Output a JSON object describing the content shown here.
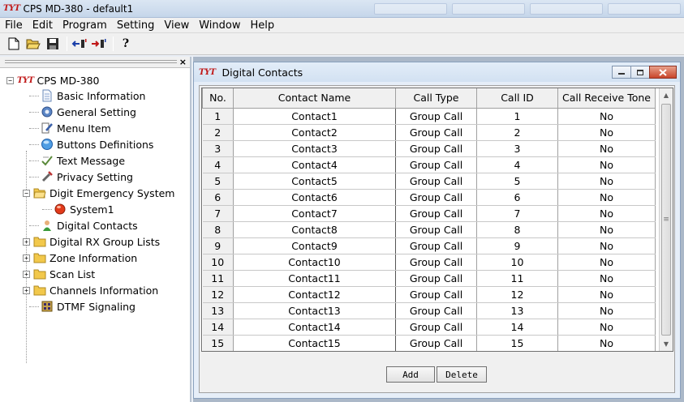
{
  "app": {
    "logo_text": "TYT",
    "title": "CPS MD-380 - default1"
  },
  "menu": [
    "File",
    "Edit",
    "Program",
    "Setting",
    "View",
    "Window",
    "Help"
  ],
  "toolbar": {
    "help_glyph": "?"
  },
  "tree": {
    "close_glyph": "×",
    "root_label": "CPS MD-380",
    "items": [
      {
        "label": "Basic Information"
      },
      {
        "label": "General Setting"
      },
      {
        "label": "Menu Item"
      },
      {
        "label": "Buttons Definitions"
      },
      {
        "label": "Text Message"
      },
      {
        "label": "Privacy Setting"
      },
      {
        "label": "Digit Emergency System"
      },
      {
        "label": "System1"
      },
      {
        "label": "Digital Contacts"
      },
      {
        "label": "Digital RX Group Lists"
      },
      {
        "label": "Zone Information"
      },
      {
        "label": "Scan List"
      },
      {
        "label": "Channels Information"
      },
      {
        "label": "DTMF Signaling"
      }
    ]
  },
  "window": {
    "title": "Digital Contacts",
    "columns": [
      "No.",
      "Contact Name",
      "Call Type",
      "Call ID",
      "Call Receive Tone"
    ],
    "rows": [
      [
        "1",
        "Contact1",
        "Group Call",
        "1",
        "No"
      ],
      [
        "2",
        "Contact2",
        "Group Call",
        "2",
        "No"
      ],
      [
        "3",
        "Contact3",
        "Group Call",
        "3",
        "No"
      ],
      [
        "4",
        "Contact4",
        "Group Call",
        "4",
        "No"
      ],
      [
        "5",
        "Contact5",
        "Group Call",
        "5",
        "No"
      ],
      [
        "6",
        "Contact6",
        "Group Call",
        "6",
        "No"
      ],
      [
        "7",
        "Contact7",
        "Group Call",
        "7",
        "No"
      ],
      [
        "8",
        "Contact8",
        "Group Call",
        "8",
        "No"
      ],
      [
        "9",
        "Contact9",
        "Group Call",
        "9",
        "No"
      ],
      [
        "10",
        "Contact10",
        "Group Call",
        "10",
        "No"
      ],
      [
        "11",
        "Contact11",
        "Group Call",
        "11",
        "No"
      ],
      [
        "12",
        "Contact12",
        "Group Call",
        "12",
        "No"
      ],
      [
        "13",
        "Contact13",
        "Group Call",
        "13",
        "No"
      ],
      [
        "14",
        "Contact14",
        "Group Call",
        "14",
        "No"
      ],
      [
        "15",
        "Contact15",
        "Group Call",
        "15",
        "No"
      ]
    ],
    "add_label": "Add",
    "delete_label": "Delete"
  },
  "colors": {
    "logo_red": "#c01818",
    "close_button": "#c8452b"
  }
}
